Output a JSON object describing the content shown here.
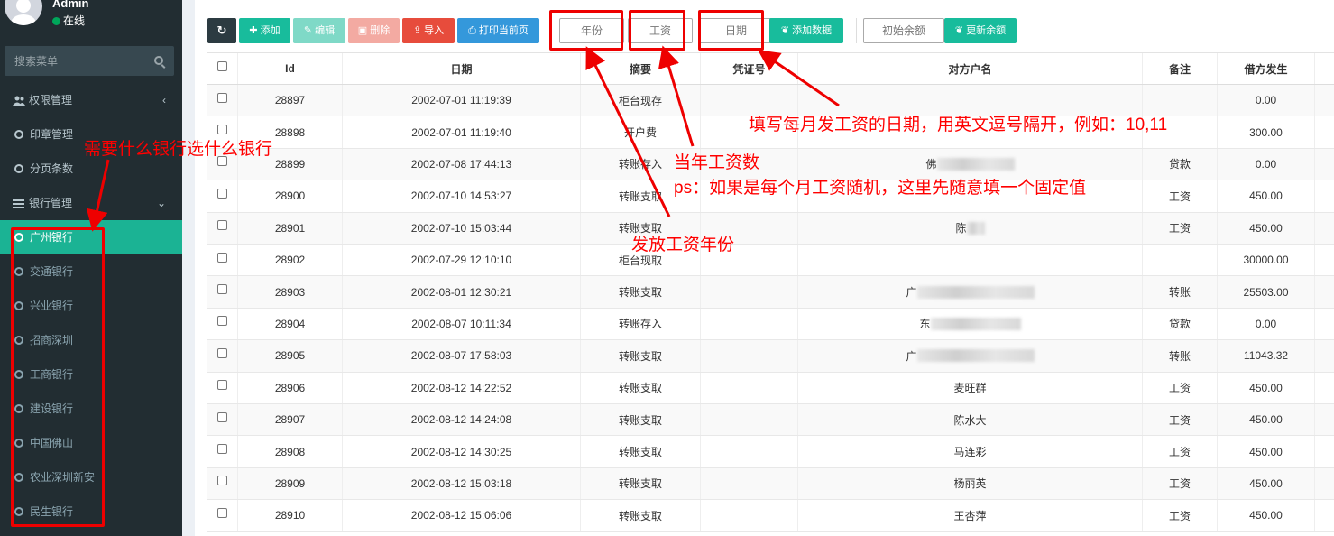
{
  "user": {
    "name": "Admin",
    "status": "在线"
  },
  "search": {
    "placeholder": "搜索菜单"
  },
  "menu": {
    "permission": "权限管理",
    "seal": "印章管理",
    "paging": "分页条数",
    "bank_mgmt": "银行管理",
    "banks": [
      "广州银行",
      "交通银行",
      "兴业银行",
      "招商深圳",
      "工商银行",
      "建设银行",
      "中国佛山",
      "农业深圳新安",
      "民生银行"
    ],
    "active_bank": "广州银行"
  },
  "toolbar": {
    "refresh_icon": "refresh-icon",
    "add": "添加",
    "edit": "编辑",
    "delete": "删除",
    "import": "导入",
    "print": "打印当前页",
    "year_placeholder": "年份",
    "salary_placeholder": "工资",
    "date_placeholder": "日期",
    "add_data": "添加数据",
    "init_balance_placeholder": "初始余额",
    "update_balance": "更新余额"
  },
  "table": {
    "headers": [
      "Id",
      "日期",
      "摘要",
      "凭证号",
      "对方户名",
      "备注",
      "借方发生"
    ],
    "rows": [
      {
        "id": "28897",
        "date": "2002-07-01 11:19:39",
        "summary": "柜台现存",
        "voucher": "",
        "party": "",
        "note": "",
        "debit": "0.00"
      },
      {
        "id": "28898",
        "date": "2002-07-01 11:19:40",
        "summary": "开户费",
        "voucher": "",
        "party": "",
        "note": "",
        "debit": "300.00"
      },
      {
        "id": "28899",
        "date": "2002-07-08 17:44:13",
        "summary": "转账存入",
        "voucher": "",
        "party": "佛",
        "note": "贷款",
        "debit": "0.00"
      },
      {
        "id": "28900",
        "date": "2002-07-10 14:53:27",
        "summary": "转账支取",
        "voucher": "",
        "party": "",
        "note": "工资",
        "debit": "450.00"
      },
      {
        "id": "28901",
        "date": "2002-07-10 15:03:44",
        "summary": "转账支取",
        "voucher": "",
        "party": "陈",
        "note": "工资",
        "debit": "450.00"
      },
      {
        "id": "28902",
        "date": "2002-07-29 12:10:10",
        "summary": "柜台现取",
        "voucher": "",
        "party": "",
        "note": "",
        "debit": "30000.00"
      },
      {
        "id": "28903",
        "date": "2002-08-01 12:30:21",
        "summary": "转账支取",
        "voucher": "",
        "party": "广",
        "note": "转账",
        "debit": "25503.00"
      },
      {
        "id": "28904",
        "date": "2002-08-07 10:11:34",
        "summary": "转账存入",
        "voucher": "",
        "party": "东",
        "note": "贷款",
        "debit": "0.00"
      },
      {
        "id": "28905",
        "date": "2002-08-07 17:58:03",
        "summary": "转账支取",
        "voucher": "",
        "party": "广",
        "note": "转账",
        "debit": "11043.32"
      },
      {
        "id": "28906",
        "date": "2002-08-12 14:22:52",
        "summary": "转账支取",
        "voucher": "",
        "party": "麦旺群",
        "note": "工资",
        "debit": "450.00"
      },
      {
        "id": "28907",
        "date": "2002-08-12 14:24:08",
        "summary": "转账支取",
        "voucher": "",
        "party": "陈水大",
        "note": "工资",
        "debit": "450.00"
      },
      {
        "id": "28908",
        "date": "2002-08-12 14:30:25",
        "summary": "转账支取",
        "voucher": "",
        "party": "马连彩",
        "note": "工资",
        "debit": "450.00"
      },
      {
        "id": "28909",
        "date": "2002-08-12 15:03:18",
        "summary": "转账支取",
        "voucher": "",
        "party": "杨丽英",
        "note": "工资",
        "debit": "450.00"
      },
      {
        "id": "28910",
        "date": "2002-08-12 15:06:06",
        "summary": "转账支取",
        "voucher": "",
        "party": "王杏萍",
        "note": "工资",
        "debit": "450.00"
      }
    ]
  },
  "annotations": {
    "bank_hint": "需要什么银行选什么银行",
    "date_hint": "填写每月发工资的日期，用英文逗号隔开，例如：10,11",
    "salary_hint_1": "当年工资数",
    "salary_hint_2": "ps：如果是每个月工资随机，这里先随意填一个固定值",
    "year_hint": "发放工资年份"
  },
  "colors": {
    "sidebar": "#222d32",
    "active": "#1bb394",
    "annotation": "#ff0000"
  }
}
